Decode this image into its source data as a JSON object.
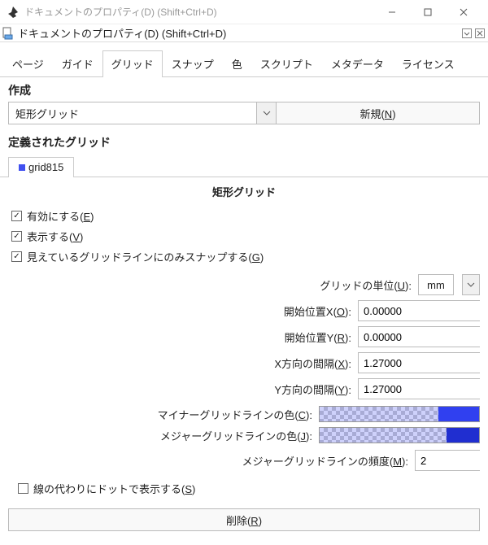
{
  "window": {
    "title": "ドキュメントのプロパティ(D) (Shift+Ctrl+D)",
    "subtitle": "ドキュメントのプロパティ(D) (Shift+Ctrl+D)"
  },
  "tabs": {
    "items": [
      "ページ",
      "ガイド",
      "グリッド",
      "スナップ",
      "色",
      "スクリプト",
      "メタデータ",
      "ライセンス"
    ],
    "active": 2
  },
  "create": {
    "label": "作成",
    "type": "矩形グリッド",
    "new_label": "新規(",
    "new_key": "N",
    "new_close": ")"
  },
  "defined": {
    "label": "定義されたグリッド",
    "grid_name": "grid815"
  },
  "grid": {
    "title": "矩形グリッド",
    "checks": {
      "enable": {
        "label": "有効にする(",
        "key": "E",
        "close": ")",
        "checked": true
      },
      "show": {
        "label": "表示する(",
        "key": "V",
        "close": ")",
        "checked": true
      },
      "snap_visible": {
        "label": "見えているグリッドラインにのみスナップする(",
        "key": "G",
        "close": ")",
        "checked": true
      },
      "dots": {
        "label": "線の代わりにドットで表示する(",
        "key": "S",
        "close": ")",
        "checked": false
      }
    },
    "unit": {
      "label": "グリッドの単位(",
      "key": "U",
      "close": "):",
      "value": "mm"
    },
    "ox": {
      "label": "開始位置X(",
      "key": "O",
      "close": "):",
      "value": "0.00000"
    },
    "oy": {
      "label": "開始位置Y(",
      "key": "R",
      "close": "):",
      "value": "0.00000"
    },
    "dx": {
      "label": "X方向の間隔(",
      "key": "X",
      "close": "):",
      "value": "1.27000"
    },
    "dy": {
      "label": "Y方向の間隔(",
      "key": "Y",
      "close": "):",
      "value": "1.27000"
    },
    "minor_color": {
      "label": "マイナーグリッドラインの色(",
      "key": "C",
      "close": "):"
    },
    "major_color": {
      "label": "メジャーグリッドラインの色(",
      "key": "J",
      "close": "):"
    },
    "major_freq": {
      "label": "メジャーグリッドラインの頻度(",
      "key": "M",
      "close": "):",
      "value": "2"
    },
    "delete": {
      "label": "削除(",
      "key": "R",
      "close": ")"
    }
  }
}
